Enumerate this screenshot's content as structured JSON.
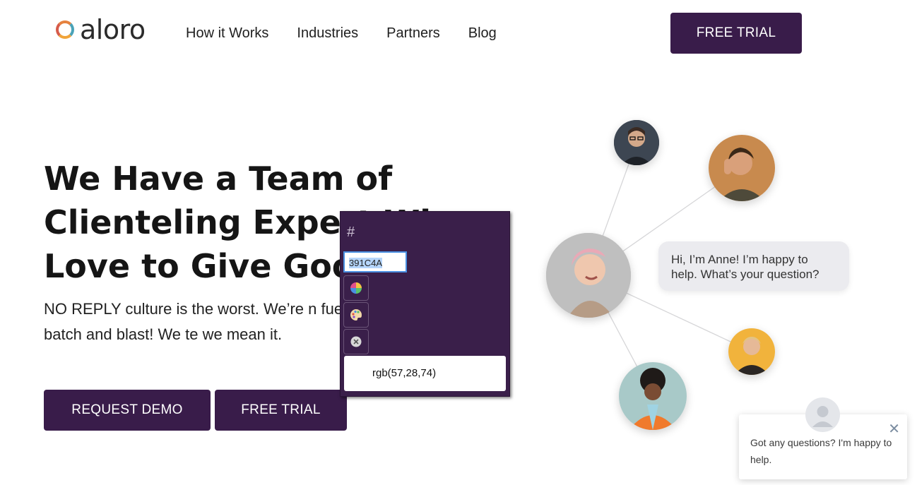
{
  "header": {
    "logo_text": "aloro",
    "nav": [
      "How it Works",
      "Industries",
      "Partners",
      "Blog"
    ],
    "cta_label": "FREE TRIAL"
  },
  "hero": {
    "title": "We Have a Team of Clienteling Expert  Wi Love to Give Good",
    "subtitle": "NO REPLY culture is the worst. We’re n fuel the fire with batch and blast! We te we mean it.",
    "request_demo_label": "REQUEST DEMO",
    "free_trial_label": "FREE TRIAL"
  },
  "color_picker": {
    "hash_label": "#",
    "hex_value": "391C4A",
    "rgb_value": "rgb(57,28,74)",
    "buttons": [
      "color-wheel-icon",
      "palette-icon",
      "clear-icon"
    ]
  },
  "illustration": {
    "bubble_text": "Hi, I’m Anne! I’m happy to help. What’s your question?"
  },
  "chat_widget": {
    "message": "Got any questions? I'm happy to help.",
    "close_symbol": "✕"
  },
  "colors": {
    "brand_purple": "#391c4a",
    "picker_bg": "#3a1f4a",
    "bubble_bg": "#ebebef"
  }
}
